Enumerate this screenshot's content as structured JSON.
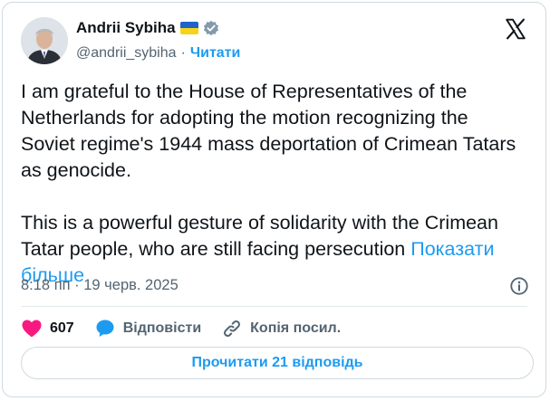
{
  "author": {
    "name": "Andrii Sybiha",
    "handle": "@andrii_sybiha",
    "separator": "·",
    "follow_label": "Читати"
  },
  "tweet": {
    "text": "I am grateful to the House of Representatives of the\nNetherlands for adopting the motion recognizing the\nSoviet regime's 1944 mass deportation of Crimean Tatars\nas genocide.\n\nThis is a powerful gesture of solidarity with the Crimean\nTatar people, who are still facing persecution ",
    "show_more": "Показати\nбільше",
    "timestamp": "8:18 пп · 19 черв. 2025"
  },
  "actions": {
    "likes_count": "607",
    "reply_label": "Відповісти",
    "copy_link_label": "Копія посил."
  },
  "read_replies_label": "Прочитати 21 відповідь",
  "colors": {
    "accent": "#1d9bf0",
    "like": "#f91880",
    "text": "#0f1419",
    "muted": "#536471",
    "border": "#cfd9de"
  }
}
